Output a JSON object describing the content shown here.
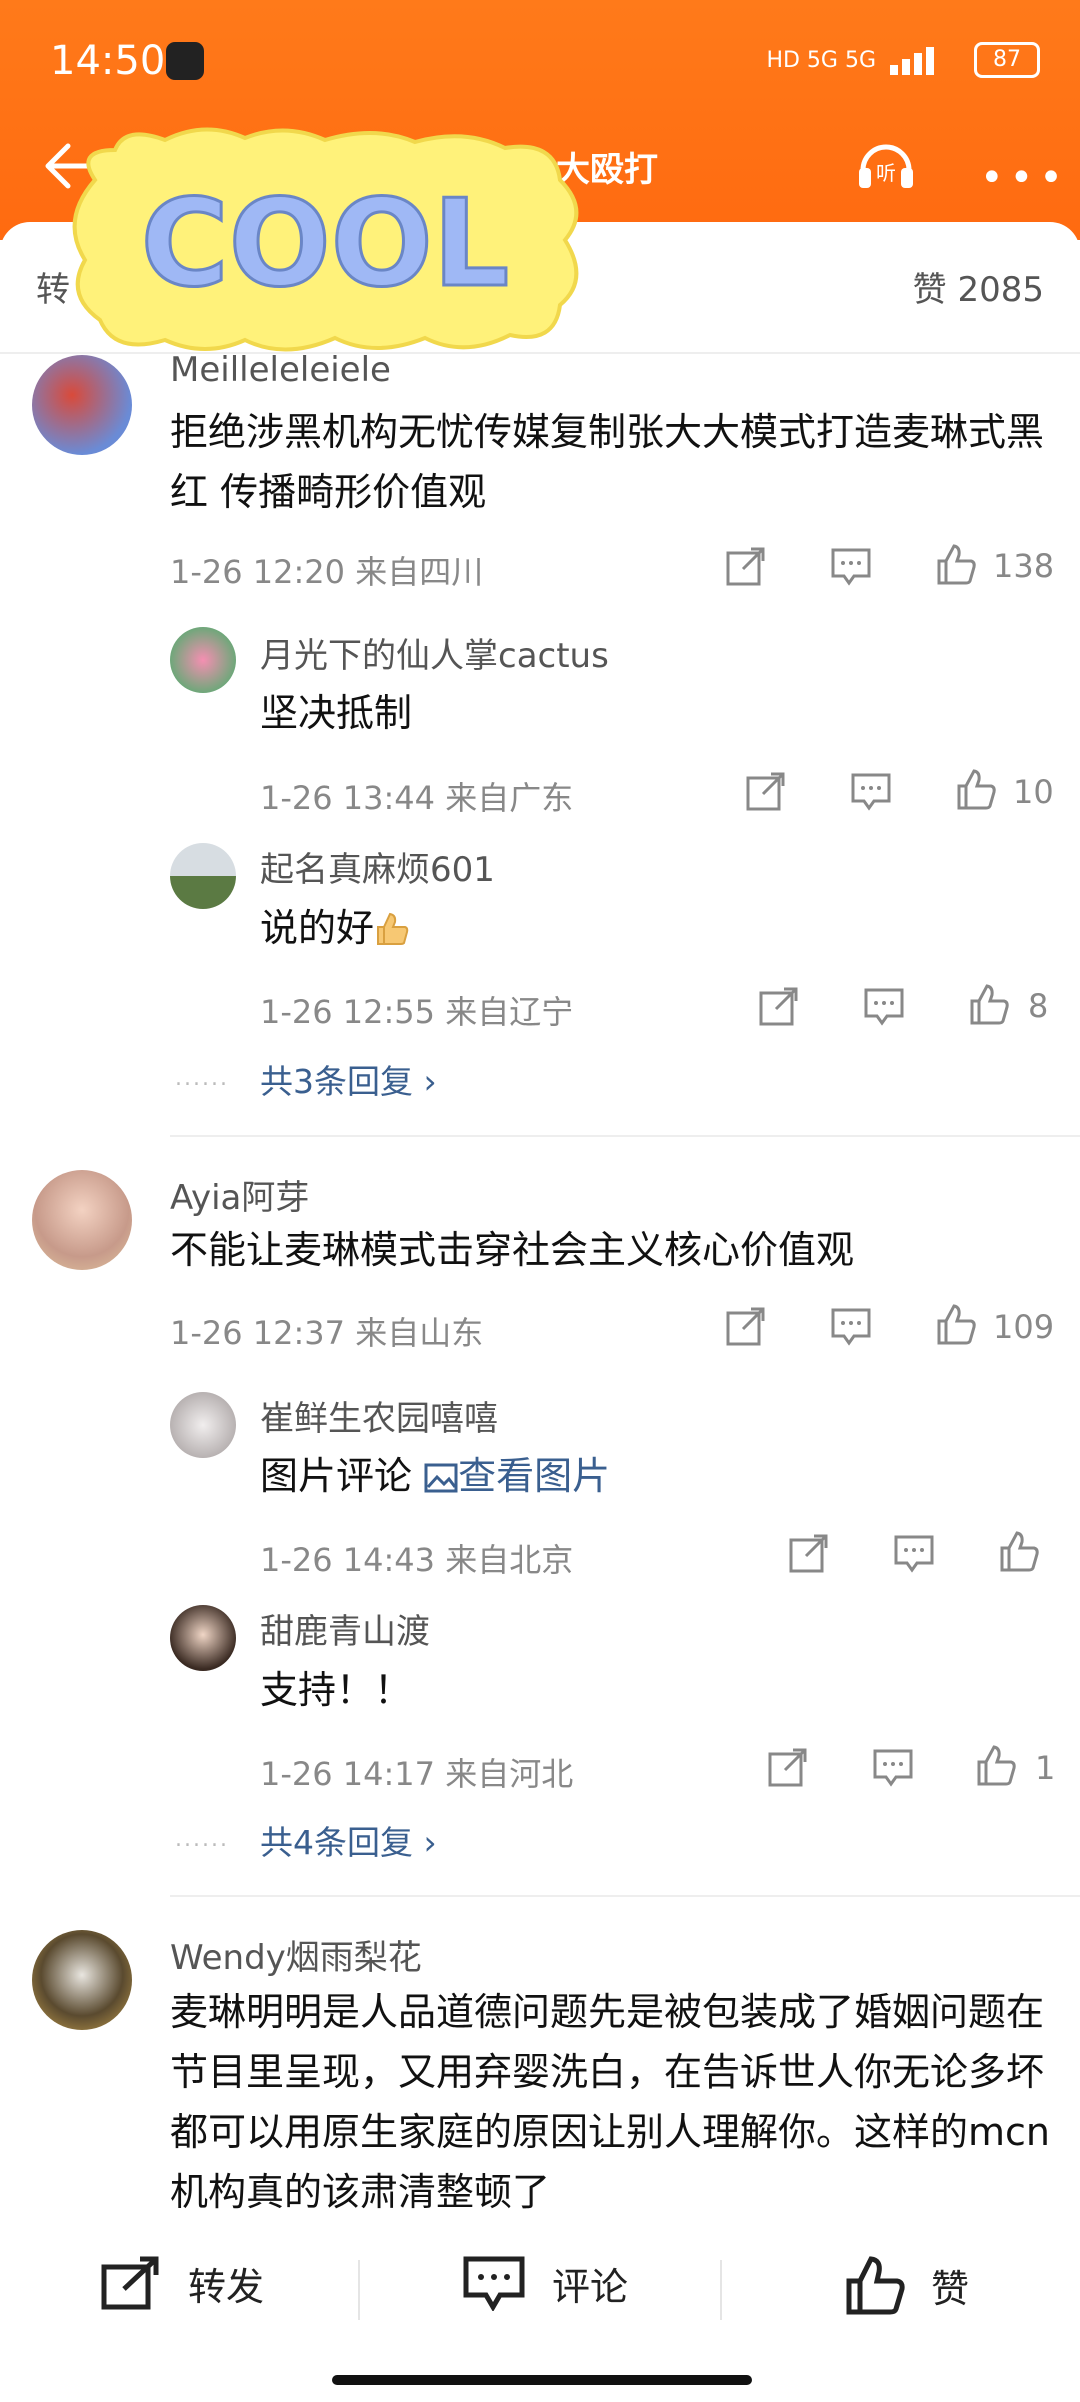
{
  "status_bar": {
    "time": "14:50",
    "network": "HD 5G 5G",
    "battery": "87"
  },
  "nav": {
    "title_fragment": "曾遭张大大殴打",
    "listen_label": "听"
  },
  "sticker_text": "COOL",
  "subbar": {
    "left": "转",
    "likes_label": "赞 2085"
  },
  "comments": [
    {
      "user": "Meilleleleiele",
      "text": "拒绝涉黑机构无忧传媒复制张大大模式打造麦琳式黑红 传播畸形价值观",
      "meta": "1-26 12:20  来自四川",
      "likes": "138",
      "replies": [
        {
          "user": "月光下的仙人掌cactus",
          "text": "坚决抵制",
          "meta": "1-26 13:44  来自广东",
          "likes": "10"
        },
        {
          "user": "起名真麻烦601",
          "text": "说的好",
          "meta": "1-26 12:55  来自辽宁",
          "likes": "8"
        }
      ],
      "more_replies": "共3条回复 ›"
    },
    {
      "user": "Ayia阿芽",
      "text": "不能让麦琳模式击穿社会主义核心价值观",
      "meta": "1-26 12:37  来自山东",
      "likes": "109",
      "replies": [
        {
          "user": "崔鲜生农园嘻嘻",
          "text": "图片评论",
          "link": "查看图片",
          "meta": "1-26 14:43  来自北京",
          "likes": ""
        },
        {
          "user": "甜鹿青山渡",
          "text": "支持！！",
          "meta": "1-26 14:17  来自河北",
          "likes": "1"
        }
      ],
      "more_replies": "共4条回复 ›"
    },
    {
      "user": "Wendy烟雨梨花",
      "text": "麦琳明明是人品道德问题先是被包装成了婚姻问题在节目里呈现，又用弃婴洗白，在告诉世人你无论多坏都可以用原生家庭的原因让别人理解你。这样的mcn机构真的该肃清整顿了"
    }
  ],
  "bottom_bar": {
    "repost": "转发",
    "comment": "评论",
    "like": "赞"
  },
  "colors": {
    "header": "#ff6a10",
    "link": "#3a5f8f"
  }
}
